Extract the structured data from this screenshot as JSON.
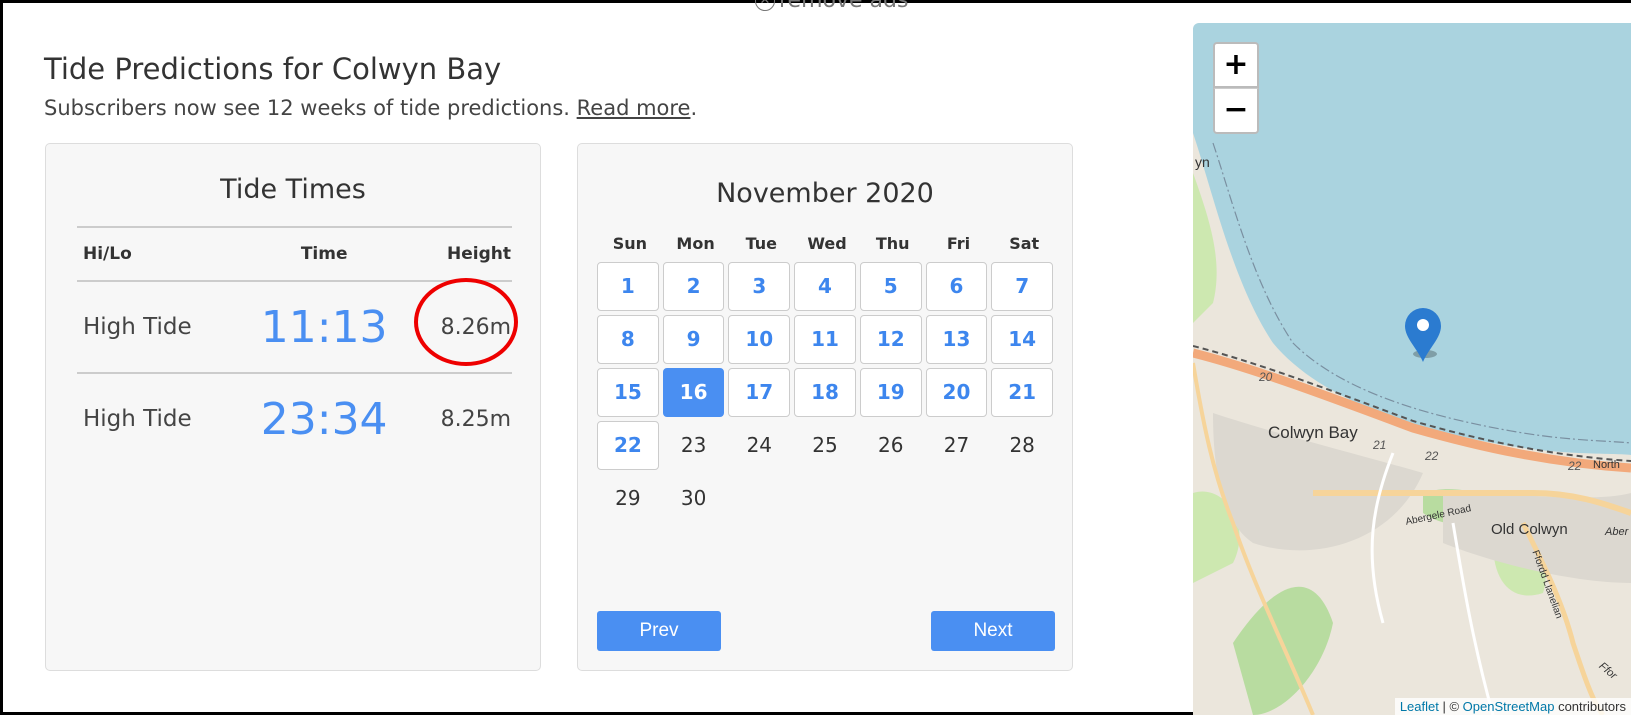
{
  "header": {
    "remove_ads": "remove ads",
    "title": "Tide Predictions for Colwyn Bay",
    "subtitle_text": "Subscribers now see 12 weeks of tide predictions. ",
    "read_more": "Read more",
    "subtitle_end": "."
  },
  "tide_times": {
    "heading": "Tide Times",
    "columns": [
      "Hi/Lo",
      "Time",
      "Height"
    ],
    "rows": [
      {
        "type": "High Tide",
        "time": "11:13",
        "height": "8.26m"
      },
      {
        "type": "High Tide",
        "time": "23:34",
        "height": "8.25m"
      }
    ]
  },
  "calendar": {
    "month_label": "November 2020",
    "weekdays": [
      "Sun",
      "Mon",
      "Tue",
      "Wed",
      "Thu",
      "Fri",
      "Sat"
    ],
    "weeks": [
      [
        "1",
        "2",
        "3",
        "4",
        "5",
        "6",
        "7"
      ],
      [
        "8",
        "9",
        "10",
        "11",
        "12",
        "13",
        "14"
      ],
      [
        "15",
        "16",
        "17",
        "18",
        "19",
        "20",
        "21"
      ],
      [
        "22",
        "23",
        "24",
        "25",
        "26",
        "27",
        "28"
      ],
      [
        "29",
        "30",
        "",
        "",
        "",
        "",
        ""
      ]
    ],
    "selected_day": "16",
    "last_linked_day": "22",
    "prev_label": "Prev",
    "next_label": "Next",
    "accent_color": "#4a8ff2"
  },
  "map": {
    "zoom_in": "+",
    "zoom_out": "−",
    "labels": {
      "place_colwyn_bay": "Colwyn Bay",
      "place_old_colwyn": "Old Colwyn",
      "road_abergele": "Abergele Road",
      "road_ffordd": "Ffordd Llanelian",
      "partial_yn": "yn",
      "partial_north": "North",
      "partial_aber": "Aber",
      "partial_ffor": "Ffor",
      "road_20": "20",
      "road_21": "21",
      "road_22a": "22",
      "road_22b": "22"
    },
    "attribution_leaflet": "Leaflet",
    "attribution_sep": " | © ",
    "attribution_osm": "OpenStreetMap",
    "attribution_end": " contributors",
    "marker_icon": "map-pin-icon"
  }
}
